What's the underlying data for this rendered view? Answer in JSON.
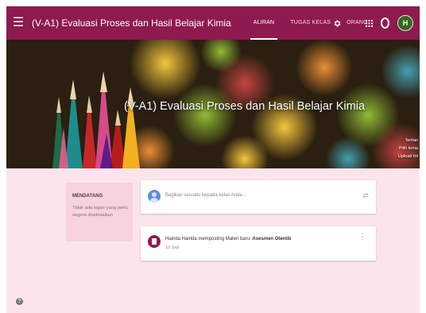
{
  "header": {
    "menu_icon": "hamburger-menu-icon",
    "title": "(V-A1) Evaluasi Proses dan Hasil Belajar Kimia",
    "tabs": [
      {
        "label": "ALIRAN",
        "active": true
      },
      {
        "label": "TUGAS KELAS",
        "active": false
      },
      {
        "label": "ORANG",
        "active": false
      }
    ],
    "icons": [
      "gear-icon",
      "apps-grid-icon",
      "notification-icon"
    ],
    "avatar_initial": "H",
    "bar_color": "#8e1a4f"
  },
  "banner": {
    "title": "(V-A1) Evaluasi Proses dan Hasil Belajar Kimia",
    "links": [
      "Tentan",
      "Pilih tema",
      "Upload fot"
    ]
  },
  "upcoming": {
    "title": "MENDATANG",
    "text": "Tidak ada tugas yang perlu segera diselesaikan"
  },
  "compose": {
    "placeholder": "Bagikan sesuatu kepada kelas Anda..."
  },
  "post": {
    "text": "Hairida Hairida memposting Materi baru: ",
    "material": "Asesmen Otentik",
    "date": "10 Sep"
  },
  "help_icon": "help-icon",
  "colors": {
    "accent": "#8e1a4f",
    "page_background": "#fce4ec"
  }
}
